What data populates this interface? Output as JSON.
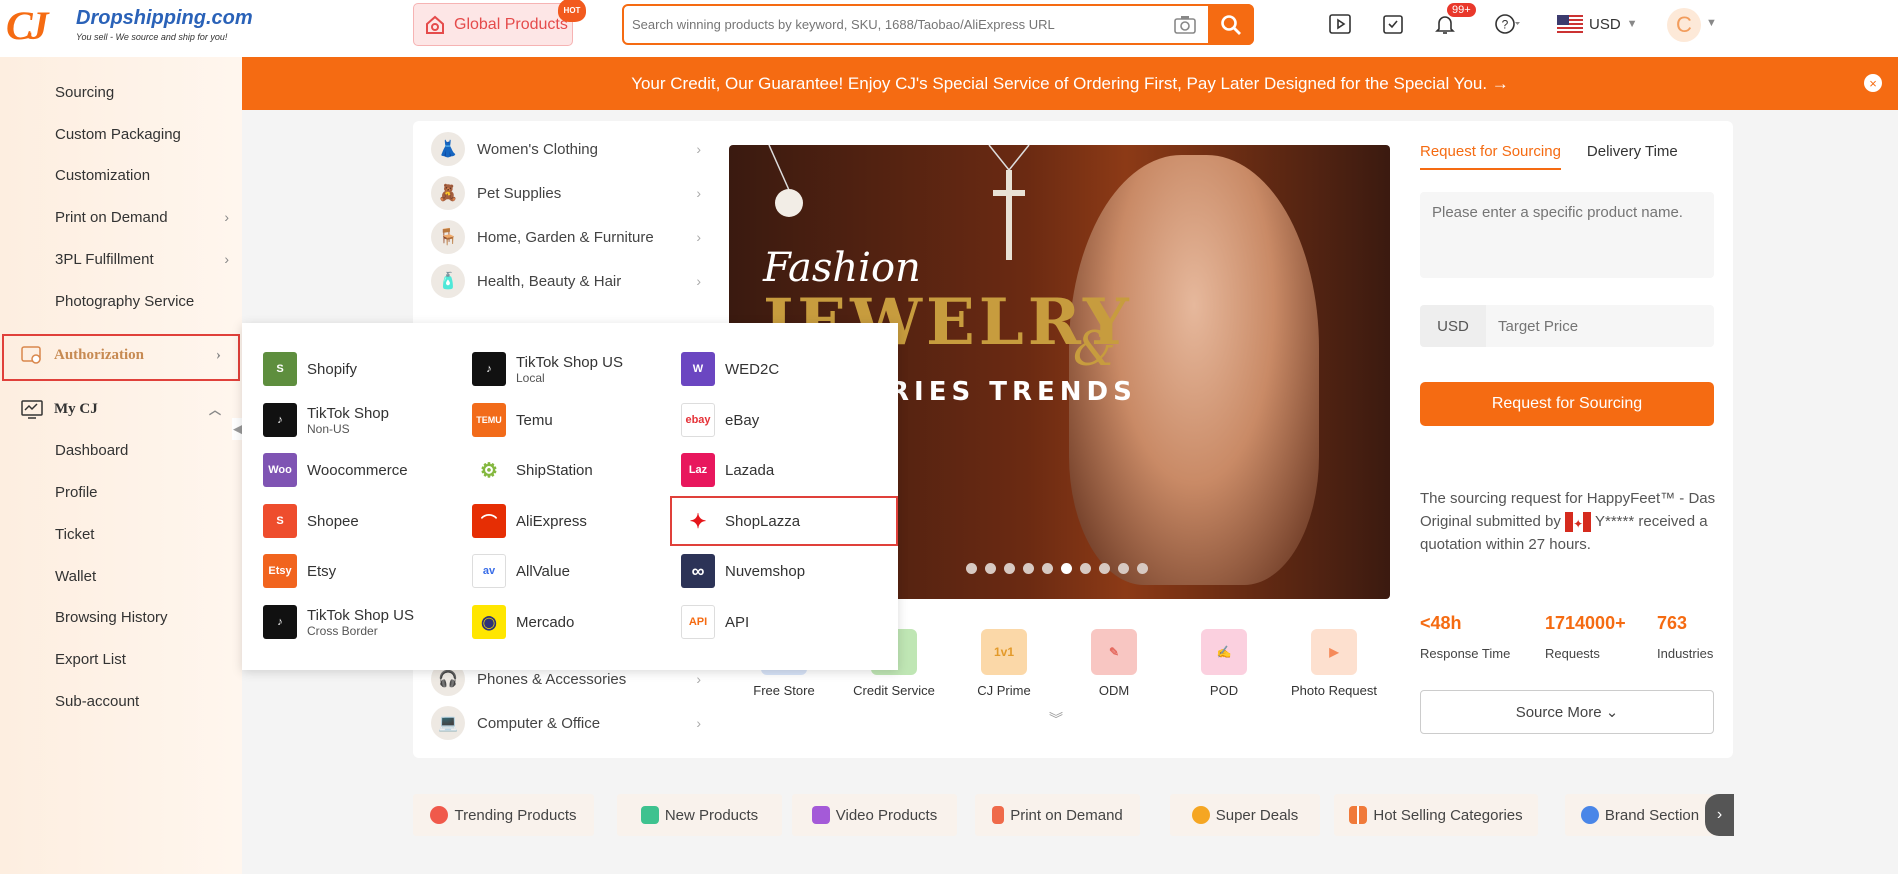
{
  "header": {
    "brand_name": "Dropshipping.com",
    "brand_tagline": "You sell - We source and ship for you!",
    "global_products": "Global Products",
    "hot_badge": "HOT",
    "search_placeholder": "Search winning products by keyword, SKU, 1688/Taobao/AliExpress URL",
    "notification_count": "99+",
    "currency": "USD",
    "avatar_letter": "C"
  },
  "notice": {
    "text": "Your Credit, Our Guarantee! Enjoy CJ's Special Service of Ordering First, Pay Later Designed for the Special You. →",
    "close": "×"
  },
  "sidebar": {
    "items_top": [
      "Sourcing",
      "Custom Packaging",
      "Customization",
      "Print on Demand",
      "3PL Fulfillment",
      "Photography Service"
    ],
    "authorization": "Authorization",
    "my_cj": "My CJ",
    "items_bottom": [
      "Dashboard",
      "Profile",
      "Ticket",
      "Wallet",
      "Browsing History",
      "Export List",
      "Sub-account"
    ]
  },
  "categories": [
    "Women's Clothing",
    "Pet Supplies",
    "Home, Garden & Furniture",
    "Health, Beauty & Hair",
    "Phones & Accessories",
    "Computer & Office"
  ],
  "hero": {
    "line1": "Fashion",
    "line2": "JEWELRY",
    "line2b": "&",
    "line3": "RIES TRENDS"
  },
  "services": [
    "Free Store",
    "Credit Service",
    "CJ Prime",
    "ODM",
    "POD",
    "Photo Request"
  ],
  "sourcing": {
    "tab_request": "Request for Sourcing",
    "tab_delivery": "Delivery Time",
    "product_placeholder": "Please enter a specific product name.",
    "currency": "USD",
    "price_placeholder": "Target Price",
    "button": "Request for Sourcing",
    "quote_prefix": "The sourcing request for HappyFeet™ - Das Original submitted by",
    "quote_user": "Y*****",
    "quote_suffix": "received a quotation within 27 hours.",
    "stats": [
      {
        "value": "<48h",
        "label": "Response Time"
      },
      {
        "value": "1714000+",
        "label": "Requests"
      },
      {
        "value": "763",
        "label": "Industries"
      }
    ],
    "source_more": "Source More ⌄"
  },
  "platforms": [
    {
      "name": "Shopify",
      "sub": "",
      "color": "#5e8e3e",
      "icon": "S"
    },
    {
      "name": "TikTok Shop US",
      "sub": "Local",
      "color": "#111111",
      "icon": "♪"
    },
    {
      "name": "WED2C",
      "sub": "",
      "color": "#6b46c1",
      "icon": "W"
    },
    {
      "name": "TikTok Shop",
      "sub": "Non-US",
      "color": "#111111",
      "icon": "♪"
    },
    {
      "name": "Temu",
      "sub": "",
      "color": "#f26b1a",
      "icon": "TEMU"
    },
    {
      "name": "eBay",
      "sub": "",
      "color": "#ffffff",
      "icon": "ebay"
    },
    {
      "name": "Woocommerce",
      "sub": "",
      "color": "#7f54b3",
      "icon": "Woo"
    },
    {
      "name": "ShipStation",
      "sub": "",
      "color": "#84b83f",
      "icon": "⚙"
    },
    {
      "name": "Lazada",
      "sub": "",
      "color": "#e8175d",
      "icon": "Laz"
    },
    {
      "name": "Shopee",
      "sub": "",
      "color": "#ee4d2d",
      "icon": "S"
    },
    {
      "name": "AliExpress",
      "sub": "",
      "color": "#e62e04",
      "icon": "⌒"
    },
    {
      "name": "ShopLazza",
      "sub": "",
      "color": "#ffffff",
      "icon": "✦"
    },
    {
      "name": "Etsy",
      "sub": "",
      "color": "#f1641e",
      "icon": "Etsy"
    },
    {
      "name": "AllValue",
      "sub": "",
      "color": "#ffffff",
      "icon": "av"
    },
    {
      "name": "Nuvemshop",
      "sub": "",
      "color": "#2c3357",
      "icon": "∞"
    },
    {
      "name": "TikTok Shop US",
      "sub": "Cross Border",
      "color": "#111111",
      "icon": "♪"
    },
    {
      "name": "Mercado",
      "sub": "",
      "color": "#ffe600",
      "icon": "◉"
    },
    {
      "name": "API",
      "sub": "",
      "color": "#ffffff",
      "icon": "API"
    }
  ],
  "bottom_tabs": [
    "Trending Products",
    "New Products",
    "Video Products",
    "Print on Demand",
    "Super Deals",
    "Hot Selling Categories",
    "Brand Section"
  ]
}
